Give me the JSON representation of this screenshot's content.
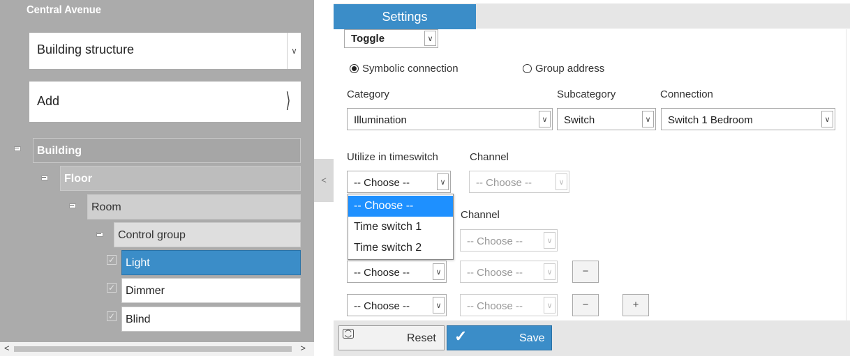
{
  "left_panel": {
    "title": "Central Avenue",
    "structure_select": {
      "value": "Building structure"
    },
    "add_button": {
      "label": "Add"
    },
    "tree": {
      "building": "Building",
      "floor": "Floor",
      "room": "Room",
      "control_group": "Control group",
      "items": [
        "Light",
        "Dimmer",
        "Blind"
      ]
    },
    "collapse_label": "<"
  },
  "tabs": {
    "settings": "Settings"
  },
  "form": {
    "mode_select": "Toggle",
    "radio_symbolic": "Symbolic connection",
    "radio_group": "Group address",
    "category_label": "Category",
    "subcategory_label": "Subcategory",
    "connection_label": "Connection",
    "category_value": "Illumination",
    "subcategory_value": "Switch",
    "connection_value": "Switch 1 Bedroom",
    "timeswitch_label": "Utilize in timeswitch",
    "channel_label": "Channel",
    "choose": "-- Choose --",
    "dropdown_options": [
      "-- Choose --",
      "Time switch 1",
      "Time switch 2"
    ],
    "minus": "−",
    "plus": "+"
  },
  "toolbar": {
    "reset": "Reset",
    "save": "Save"
  },
  "colors": {
    "accent": "#3b8dc8",
    "tree_selected": "#3b8dc8",
    "panel_bg": "#ababab"
  }
}
